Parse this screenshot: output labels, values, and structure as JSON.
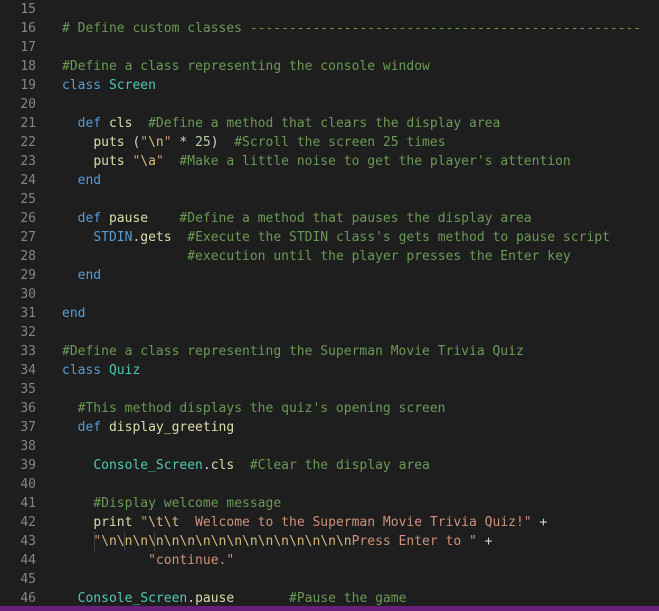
{
  "colors": {
    "background": "#1e1e1e",
    "line_number": "#858585",
    "comment": "#6a9955",
    "keyword": "#569cd6",
    "class": "#4ec9b0",
    "method": "#dcdcaa",
    "string": "#ce9178",
    "escape": "#d7ba7d",
    "number": "#b5cea8",
    "text": "#d4d4d4",
    "status_bar": "#68217a"
  },
  "lines": [
    {
      "n": "15",
      "tokens": []
    },
    {
      "n": "16",
      "tokens": [
        {
          "t": "comment",
          "v": "# Define custom classes --------------------------------------------------"
        }
      ]
    },
    {
      "n": "17",
      "tokens": []
    },
    {
      "n": "18",
      "tokens": [
        {
          "t": "comment",
          "v": "#Define a class representing the console window"
        }
      ]
    },
    {
      "n": "19",
      "tokens": [
        {
          "t": "keyword",
          "v": "class"
        },
        {
          "t": "plain",
          "v": " "
        },
        {
          "t": "class",
          "v": "Screen"
        }
      ]
    },
    {
      "n": "20",
      "tokens": []
    },
    {
      "n": "21",
      "tokens": [
        {
          "t": "plain",
          "v": "  "
        },
        {
          "t": "keyword",
          "v": "def"
        },
        {
          "t": "plain",
          "v": " "
        },
        {
          "t": "method",
          "v": "cls"
        },
        {
          "t": "plain",
          "v": "  "
        },
        {
          "t": "comment",
          "v": "#Define a method that clears the display area"
        }
      ]
    },
    {
      "n": "22",
      "tokens": [
        {
          "t": "plain",
          "v": "    "
        },
        {
          "t": "method",
          "v": "puts"
        },
        {
          "t": "plain",
          "v": " ("
        },
        {
          "t": "string",
          "v": "\""
        },
        {
          "t": "escape",
          "v": "\\n"
        },
        {
          "t": "string",
          "v": "\""
        },
        {
          "t": "plain",
          "v": " * "
        },
        {
          "t": "number",
          "v": "25"
        },
        {
          "t": "plain",
          "v": ")  "
        },
        {
          "t": "comment",
          "v": "#Scroll the screen 25 times"
        }
      ]
    },
    {
      "n": "23",
      "tokens": [
        {
          "t": "plain",
          "v": "    "
        },
        {
          "t": "method",
          "v": "puts"
        },
        {
          "t": "plain",
          "v": " "
        },
        {
          "t": "string",
          "v": "\""
        },
        {
          "t": "escape",
          "v": "\\a"
        },
        {
          "t": "string",
          "v": "\""
        },
        {
          "t": "plain",
          "v": "  "
        },
        {
          "t": "comment",
          "v": "#Make a little noise to get the player's attention"
        }
      ]
    },
    {
      "n": "24",
      "tokens": [
        {
          "t": "plain",
          "v": "  "
        },
        {
          "t": "keyword",
          "v": "end"
        }
      ]
    },
    {
      "n": "25",
      "tokens": []
    },
    {
      "n": "26",
      "tokens": [
        {
          "t": "plain",
          "v": "  "
        },
        {
          "t": "keyword",
          "v": "def"
        },
        {
          "t": "plain",
          "v": " "
        },
        {
          "t": "method",
          "v": "pause"
        },
        {
          "t": "plain",
          "v": "    "
        },
        {
          "t": "comment",
          "v": "#Define a method that pauses the display area"
        }
      ]
    },
    {
      "n": "27",
      "tokens": [
        {
          "t": "plain",
          "v": "    "
        },
        {
          "t": "keyword",
          "v": "STDIN"
        },
        {
          "t": "plain",
          "v": "."
        },
        {
          "t": "method",
          "v": "gets"
        },
        {
          "t": "plain",
          "v": "  "
        },
        {
          "t": "comment",
          "v": "#Execute the STDIN class's gets method to pause script"
        }
      ]
    },
    {
      "n": "28",
      "tokens": [
        {
          "t": "plain",
          "v": "                "
        },
        {
          "t": "comment",
          "v": "#execution until the player presses the Enter key"
        }
      ]
    },
    {
      "n": "29",
      "tokens": [
        {
          "t": "plain",
          "v": "  "
        },
        {
          "t": "keyword",
          "v": "end"
        }
      ]
    },
    {
      "n": "30",
      "tokens": []
    },
    {
      "n": "31",
      "tokens": [
        {
          "t": "keyword",
          "v": "end"
        }
      ]
    },
    {
      "n": "32",
      "tokens": []
    },
    {
      "n": "33",
      "tokens": [
        {
          "t": "comment",
          "v": "#Define a class representing the Superman Movie Trivia Quiz"
        }
      ]
    },
    {
      "n": "34",
      "tokens": [
        {
          "t": "keyword",
          "v": "class"
        },
        {
          "t": "plain",
          "v": " "
        },
        {
          "t": "class",
          "v": "Quiz"
        }
      ]
    },
    {
      "n": "35",
      "tokens": []
    },
    {
      "n": "36",
      "tokens": [
        {
          "t": "plain",
          "v": "  "
        },
        {
          "t": "comment",
          "v": "#This method displays the quiz's opening screen"
        }
      ]
    },
    {
      "n": "37",
      "tokens": [
        {
          "t": "plain",
          "v": "  "
        },
        {
          "t": "keyword",
          "v": "def"
        },
        {
          "t": "plain",
          "v": " "
        },
        {
          "t": "method",
          "v": "display_greeting"
        }
      ]
    },
    {
      "n": "38",
      "tokens": []
    },
    {
      "n": "39",
      "tokens": [
        {
          "t": "plain",
          "v": "    "
        },
        {
          "t": "class",
          "v": "Console_Screen"
        },
        {
          "t": "plain",
          "v": "."
        },
        {
          "t": "method",
          "v": "cls"
        },
        {
          "t": "plain",
          "v": "  "
        },
        {
          "t": "comment",
          "v": "#Clear the display area"
        }
      ]
    },
    {
      "n": "40",
      "tokens": []
    },
    {
      "n": "41",
      "tokens": [
        {
          "t": "plain",
          "v": "    "
        },
        {
          "t": "comment",
          "v": "#Display welcome message"
        }
      ]
    },
    {
      "n": "42",
      "tokens": [
        {
          "t": "plain",
          "v": "    "
        },
        {
          "t": "method",
          "v": "print"
        },
        {
          "t": "plain",
          "v": " "
        },
        {
          "t": "string",
          "v": "\""
        },
        {
          "t": "escape",
          "v": "\\t\\t"
        },
        {
          "t": "string",
          "v": "  Welcome to the Superman Movie Trivia Quiz!\""
        },
        {
          "t": "plain",
          "v": " +"
        }
      ]
    },
    {
      "n": "43",
      "tokens": [
        {
          "t": "plain",
          "v": "    "
        },
        {
          "t": "string",
          "v": "\""
        },
        {
          "t": "escape",
          "v": "\\n\\n\\n\\n\\n\\n\\n\\n\\n\\n\\n\\n\\n\\n\\n\\n"
        },
        {
          "t": "string",
          "v": "Press Enter to \""
        },
        {
          "t": "plain",
          "v": " +"
        }
      ]
    },
    {
      "n": "44",
      "tokens": [
        {
          "t": "plain",
          "v": "           "
        },
        {
          "t": "string",
          "v": "\"continue.\""
        }
      ]
    },
    {
      "n": "45",
      "tokens": []
    },
    {
      "n": "46",
      "tokens": [
        {
          "t": "plain",
          "v": "  "
        },
        {
          "t": "class",
          "v": "Console_Screen"
        },
        {
          "t": "plain",
          "v": "."
        },
        {
          "t": "method",
          "v": "pause"
        },
        {
          "t": "plain",
          "v": "       "
        },
        {
          "t": "comment",
          "v": "#Pause the game"
        }
      ]
    }
  ]
}
